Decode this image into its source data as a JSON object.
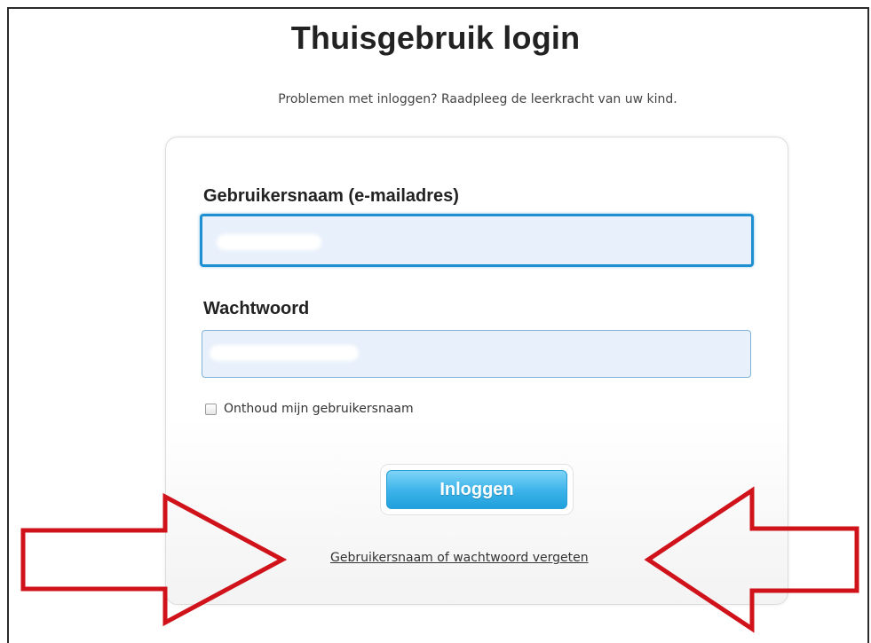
{
  "page": {
    "title": "Thuisgebruik login",
    "subtitle": "Problemen met inloggen? Raadpleeg de leerkracht van uw kind."
  },
  "form": {
    "username_label": "Gebruikersnaam (e-mailadres)",
    "username_value": "",
    "password_label": "Wachtwoord",
    "password_value": "",
    "remember_label": "Onthoud mijn gebruikersnaam",
    "remember_checked": false,
    "login_button": "Inloggen",
    "forgot_link": "Gebruikersnaam of wachtwoord vergeten"
  },
  "annotations": {
    "arrow_color": "#d0131a",
    "arrows": [
      "left-arrow-pointing-right",
      "right-arrow-pointing-left"
    ]
  },
  "colors": {
    "input_background": "#e8f0fb",
    "input_focus_border": "#1e8fd0",
    "button_blue": "#3fb5ea"
  }
}
